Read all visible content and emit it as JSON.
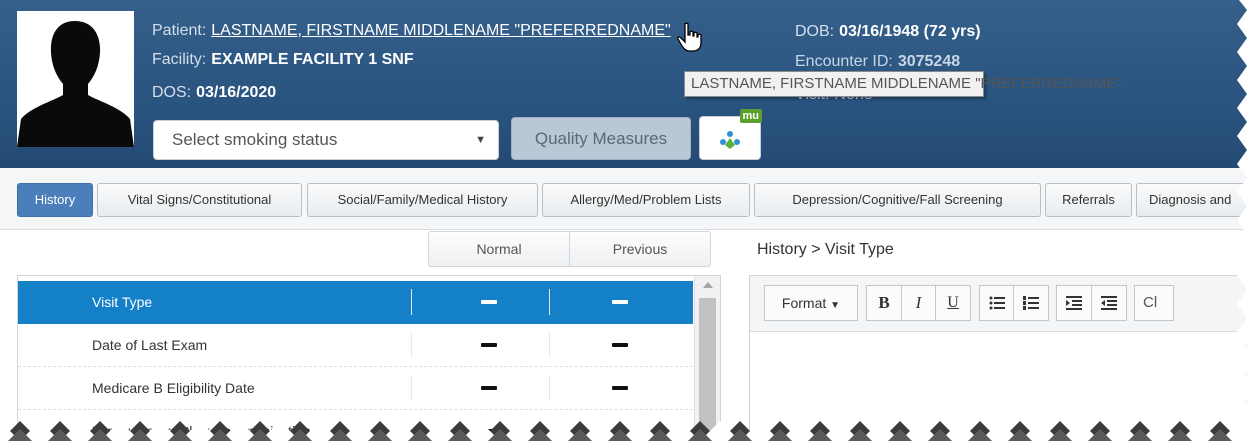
{
  "header": {
    "patient_label": "Patient:",
    "patient_name": "LASTNAME, FIRSTNAME MIDDLENAME \"PREFERREDNAME\"",
    "facility_label": "Facility:",
    "facility_value": "EXAMPLE FACILITY 1 SNF",
    "dos_label": "DOS:",
    "dos_value": "03/16/2020",
    "dob_label": "DOB:",
    "dob_value": "03/16/1948 (72 yrs)",
    "encounter_label": "Encounter ID:",
    "encounter_value": "3075248",
    "visit_label": "Visit:",
    "visit_value": "None",
    "tooltip": "LASTNAME, FIRSTNAME MIDDLENAME \"PREFERREDNAME\"",
    "smoking_placeholder": "Select smoking status",
    "quality_measures_label": "Quality Measures",
    "mu_badge": "mu"
  },
  "tabs": [
    {
      "label": "History",
      "active": true
    },
    {
      "label": "Vital Signs/Constitutional"
    },
    {
      "label": "Social/Family/Medical History"
    },
    {
      "label": "Allergy/Med/Problem Lists"
    },
    {
      "label": "Depression/Cognitive/Fall Screening"
    },
    {
      "label": "Referrals"
    },
    {
      "label": "Diagnosis and"
    }
  ],
  "left_panel": {
    "segment_normal": "Normal",
    "segment_previous": "Previous",
    "rows": [
      {
        "label": "Visit Type",
        "selected": true
      },
      {
        "label": "Date of Last Exam"
      },
      {
        "label": "Medicare B Eligibility Date"
      },
      {
        "label": "Language or Other Communication"
      }
    ]
  },
  "right_panel": {
    "breadcrumb": "History > Visit Type",
    "toolbar": {
      "format_label": "Format",
      "bold_label": "B",
      "italic_label": "I",
      "underline_label": "U",
      "clear_label": "Cl"
    }
  },
  "colors": {
    "header_bg": "#2a5480",
    "active_tab": "#4a7fbc",
    "selected_row": "#1480c8"
  }
}
